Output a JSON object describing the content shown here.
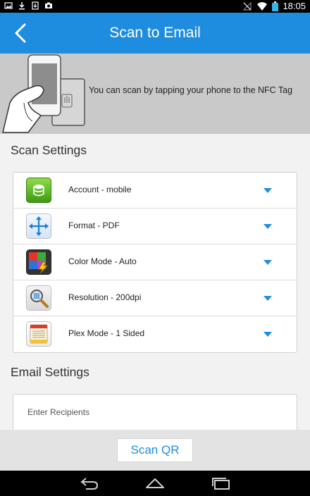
{
  "status_bar": {
    "time": "18:05",
    "left_icons": [
      "image-notification-icon",
      "download-icon",
      "download-complete-icon",
      "camera-notification-icon"
    ],
    "right_icons": [
      "signal-off-icon",
      "wifi-icon",
      "battery-icon"
    ]
  },
  "header": {
    "title": "Scan to Email",
    "back_icon": "back-chevron-icon"
  },
  "nfc_banner": {
    "text": "You can scan by tapping your phone to the NFC Tag"
  },
  "scan_settings": {
    "heading": "Scan Settings",
    "items": [
      {
        "label": "Account - mobile",
        "icon": "account-icon"
      },
      {
        "label": "Format - PDF",
        "icon": "format-icon"
      },
      {
        "label": "Color Mode - Auto",
        "icon": "color-mode-icon"
      },
      {
        "label": "Resolution - 200dpi",
        "icon": "resolution-icon"
      },
      {
        "label": "Plex Mode - 1 Sided",
        "icon": "plex-mode-icon"
      }
    ]
  },
  "email_settings": {
    "heading": "Email Settings",
    "recipients_placeholder": "Enter Recipients",
    "recipients_value": ""
  },
  "bottom": {
    "scan_qr_label": "Scan QR"
  },
  "nav": {
    "icons": [
      "back-nav-icon",
      "home-nav-icon",
      "recents-nav-icon"
    ]
  },
  "colors": {
    "accent": "#1f8ddf",
    "banner_bg": "#c9c9c9",
    "page_bg": "#f2f2f2"
  }
}
